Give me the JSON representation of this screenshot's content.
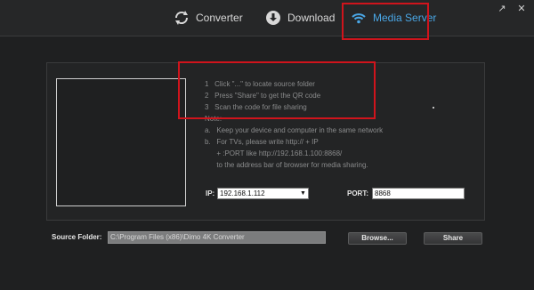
{
  "tabs": [
    {
      "label": "Converter",
      "icon": "refresh-icon"
    },
    {
      "label": "Download",
      "icon": "download-icon"
    },
    {
      "label": "Media Server",
      "icon": "wifi-icon",
      "active": true
    }
  ],
  "window_controls": [
    "external-link-icon",
    "close-icon"
  ],
  "instructions": {
    "step1": "1   Click \"...\" to locate source folder",
    "step2": "2   Press \"Share\" to get the QR code",
    "step3": "3   Scan the code for file sharing",
    "note_label": "Note:",
    "note_a": "a.   Keep your device and computer in the same network",
    "note_b": "b.   For TVs, please write http:// + IP",
    "note_b2": "      + :PORT like http://192.168.1.100:8868/",
    "note_b3": "      to the address bar of browser for media sharing."
  },
  "ip": {
    "label": "IP:",
    "value": "192.168.1.112"
  },
  "port": {
    "label": "PORT:",
    "value": "8868"
  },
  "source_folder": {
    "label": "Source Folder:",
    "value": "C:\\Program Files (x86)\\Dimo 4K Converter"
  },
  "buttons": {
    "browse": "Browse...",
    "share": "Share"
  },
  "colors": {
    "accent": "#4aa7e6",
    "highlight": "#d0141c",
    "background": "#1f2021"
  }
}
